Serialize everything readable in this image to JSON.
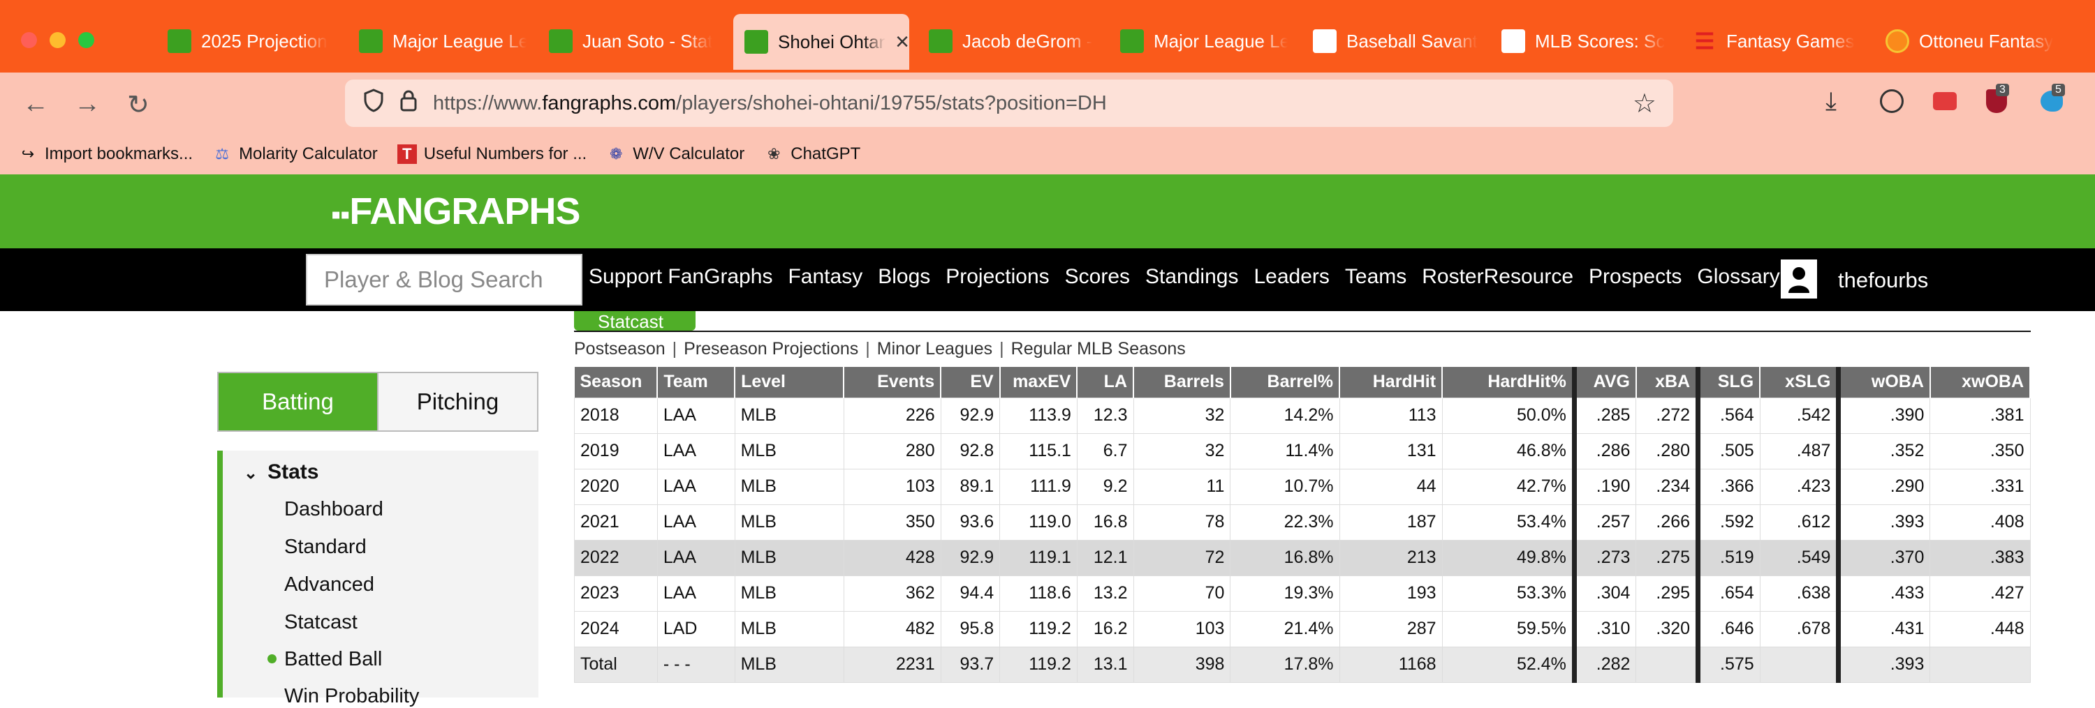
{
  "browser": {
    "tabs": [
      {
        "label": "2025 Projection",
        "icon": "fangraphs-icon"
      },
      {
        "label": "Major League Le",
        "icon": "fangraphs-icon"
      },
      {
        "label": "Juan Soto - Stat",
        "icon": "fangraphs-icon"
      },
      {
        "label": "Shohei Ohtan",
        "icon": "fangraphs-icon",
        "active": true
      },
      {
        "label": "Jacob deGrom -",
        "icon": "fangraphs-icon"
      },
      {
        "label": "Major League Le",
        "icon": "fangraphs-icon"
      },
      {
        "label": "Baseball Savant",
        "icon": "mlb-icon"
      },
      {
        "label": "MLB Scores: Sc",
        "icon": "mlb-icon"
      },
      {
        "label": "Fantasy Games",
        "icon": "espn-icon"
      },
      {
        "label": "Ottoneu Fantasy",
        "icon": "ottoneu-icon"
      }
    ],
    "url_prefix": "https://www.",
    "url_domain": "fangraphs.com",
    "url_path": "/players/shohei-ohtani/19755/stats?position=DH",
    "badge_a": "3",
    "badge_b": "5",
    "bookmarks": [
      "Import bookmarks...",
      "Molarity Calculator",
      "Useful Numbers for ...",
      "W/V Calculator",
      "ChatGPT"
    ]
  },
  "site": {
    "logo": "FANGRAPHS",
    "search_placeholder": "Player & Blog Search",
    "menu": [
      "Support FanGraphs",
      "Fantasy",
      "Blogs",
      "Projections",
      "Scores",
      "Standings",
      "Leaders",
      "Teams",
      "RosterResource",
      "Prospects",
      "Glossary"
    ],
    "username": "thefourbs"
  },
  "page": {
    "section_tab": "Statcast",
    "sublinks": [
      "Postseason",
      "Preseason Projections",
      "Minor Leagues",
      "Regular MLB Seasons"
    ],
    "toggle": {
      "batting": "Batting",
      "pitching": "Pitching"
    },
    "sidebar": {
      "header": "Stats",
      "items": [
        "Dashboard",
        "Standard",
        "Advanced",
        "Statcast",
        "Batted Ball",
        "Win Probability"
      ]
    }
  },
  "table": {
    "columns": [
      "Season",
      "Team",
      "Level",
      "Events",
      "EV",
      "maxEV",
      "LA",
      "Barrels",
      "Barrel%",
      "HardHit",
      "HardHit%",
      "AVG",
      "xBA",
      "SLG",
      "xSLG",
      "wOBA",
      "xwOBA"
    ],
    "rows": [
      [
        "2018",
        "LAA",
        "MLB",
        "226",
        "92.9",
        "113.9",
        "12.3",
        "32",
        "14.2%",
        "113",
        "50.0%",
        ".285",
        ".272",
        ".564",
        ".542",
        ".390",
        ".381"
      ],
      [
        "2019",
        "LAA",
        "MLB",
        "280",
        "92.8",
        "115.1",
        "6.7",
        "32",
        "11.4%",
        "131",
        "46.8%",
        ".286",
        ".280",
        ".505",
        ".487",
        ".352",
        ".350"
      ],
      [
        "2020",
        "LAA",
        "MLB",
        "103",
        "89.1",
        "111.9",
        "9.2",
        "11",
        "10.7%",
        "44",
        "42.7%",
        ".190",
        ".234",
        ".366",
        ".423",
        ".290",
        ".331"
      ],
      [
        "2021",
        "LAA",
        "MLB",
        "350",
        "93.6",
        "119.0",
        "16.8",
        "78",
        "22.3%",
        "187",
        "53.4%",
        ".257",
        ".266",
        ".592",
        ".612",
        ".393",
        ".408"
      ],
      [
        "2022",
        "LAA",
        "MLB",
        "428",
        "92.9",
        "119.1",
        "12.1",
        "72",
        "16.8%",
        "213",
        "49.8%",
        ".273",
        ".275",
        ".519",
        ".549",
        ".370",
        ".383"
      ],
      [
        "2023",
        "LAA",
        "MLB",
        "362",
        "94.4",
        "118.6",
        "13.2",
        "70",
        "19.3%",
        "193",
        "53.3%",
        ".304",
        ".295",
        ".654",
        ".638",
        ".433",
        ".427"
      ],
      [
        "2024",
        "LAD",
        "MLB",
        "482",
        "95.8",
        "119.2",
        "16.2",
        "103",
        "21.4%",
        "287",
        "59.5%",
        ".310",
        ".320",
        ".646",
        ".678",
        ".431",
        ".448"
      ],
      [
        "Total",
        "- - -",
        "MLB",
        "2231",
        "93.7",
        "119.2",
        "13.1",
        "398",
        "17.8%",
        "1168",
        "52.4%",
        ".282",
        "",
        ".575",
        "",
        ".393",
        ""
      ]
    ]
  }
}
